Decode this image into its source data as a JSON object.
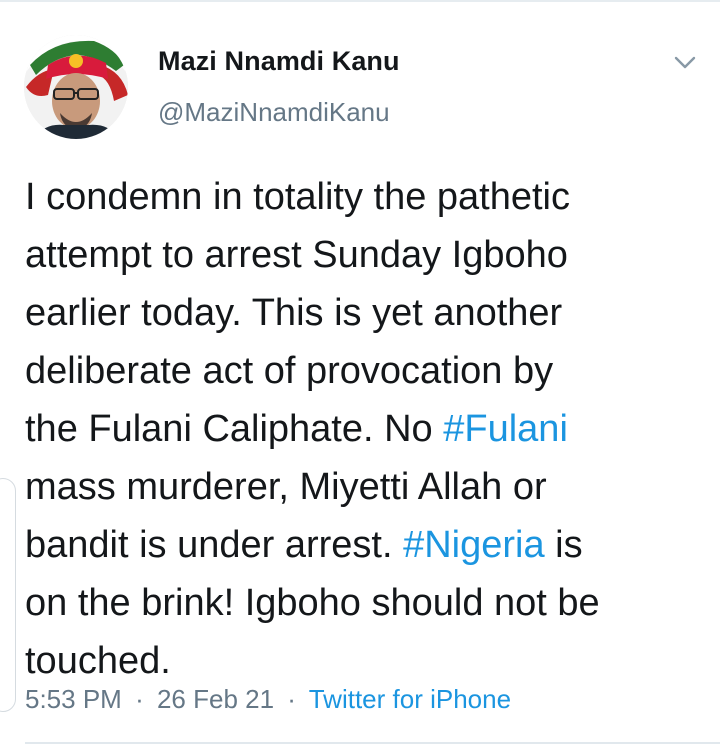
{
  "author": {
    "name": "Mazi Nnamdi Kanu",
    "handle": "@MaziNnamdiKanu",
    "avatar_icon": "profile-photo"
  },
  "menu_icon": "chevron-down-icon",
  "tweet": {
    "line1": "I condemn in totality the pathetic",
    "line2": "attempt to arrest Sunday Igboho",
    "line3": "earlier today. This is yet another",
    "line4": "deliberate act of provocation by",
    "line5_text": "the Fulani Caliphate. No ",
    "hashtag_fulani": "#Fulani",
    "line6": "mass murderer, Miyetti Allah or",
    "line7_text": "bandit is under arrest. ",
    "hashtag_nigeria": "#Nigeria",
    "line7_tail": " is",
    "line8": "on the brink! Igboho should not be",
    "line9": "touched."
  },
  "meta": {
    "time": "5:53 PM",
    "date": "26 Feb 21",
    "separator": "·",
    "source": "Twitter for iPhone"
  },
  "colors": {
    "link": "#1b95e0",
    "text": "#14171a",
    "muted": "#657786"
  }
}
